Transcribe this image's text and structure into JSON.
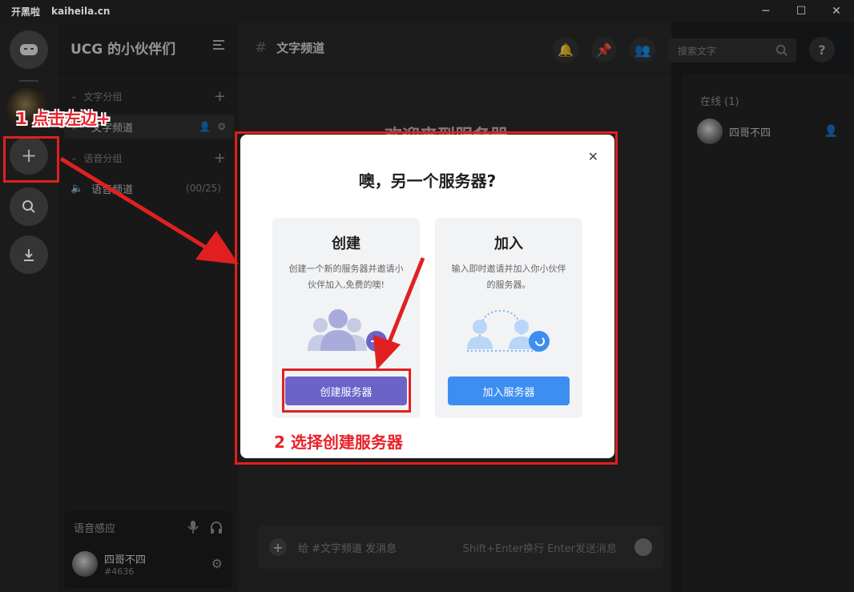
{
  "titlebar": {
    "app_name": "开黑啦",
    "url": "kaiheila.cn"
  },
  "server": {
    "name": "UCG 的小伙伴们"
  },
  "sidebar": {
    "text_group": "文字分组",
    "text_channel": "文字频道",
    "voice_group": "语音分组",
    "voice_channel": "语音频道",
    "voice_count": "(00/25)"
  },
  "user_panel": {
    "voice_label": "语音感应",
    "username": "四哥不四",
    "tag": "#4636"
  },
  "main": {
    "channel_title": "文字频道",
    "search_placeholder": "搜索文字",
    "welcome_ghost": "欢迎来到服务器",
    "composer_placeholder": "给 #文字频道 发消息",
    "composer_hint": "Shift+Enter换行 Enter发送消息"
  },
  "members": {
    "online_header": "在线 (1)",
    "member_name": "四哥不四"
  },
  "modal": {
    "title": "噢，另一个服务器?",
    "create": {
      "title": "创建",
      "desc": "创建一个新的服务器并邀请小伙伴加入,免费的噢!",
      "button": "创建服务器"
    },
    "join": {
      "title": "加入",
      "desc": "输入即时邀请并加入你小伙伴的服务器。",
      "button": "加入服务器"
    }
  },
  "annotations": {
    "step1": "1 点击左边+",
    "step2": "2 选择创建服务器",
    "color": "#e02020"
  },
  "colors": {
    "create_button": "#6c63c8",
    "join_button": "#3d8ef0",
    "badge": "#d4a017"
  }
}
